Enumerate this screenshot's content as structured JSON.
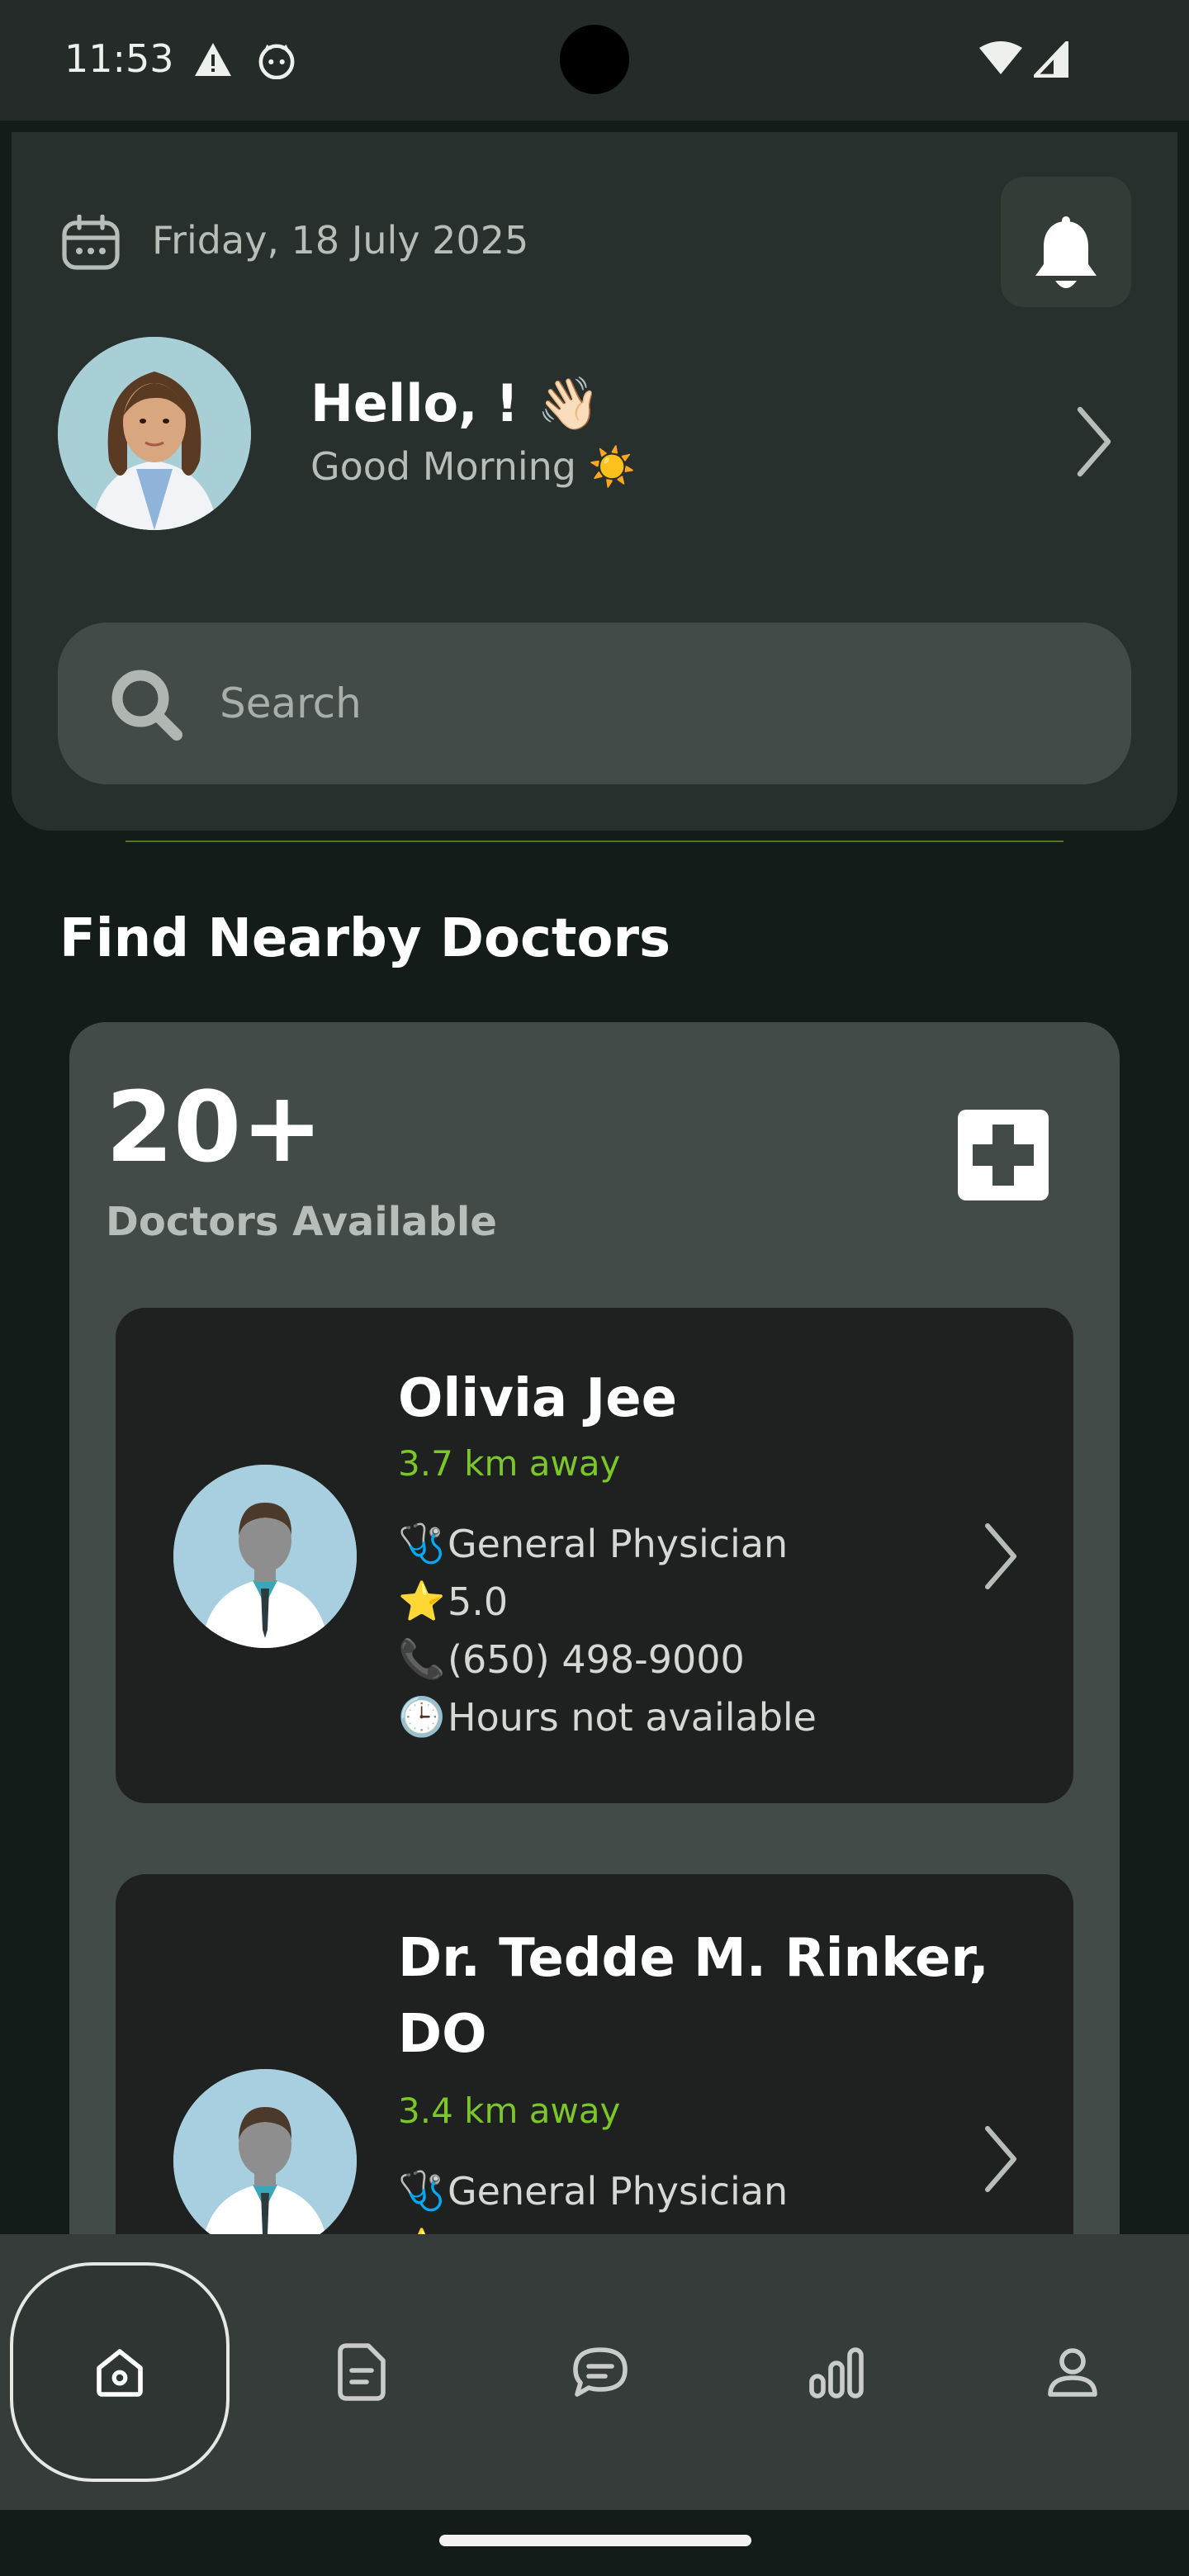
{
  "status_bar": {
    "time": "11:53"
  },
  "header": {
    "date": "Friday, 18 July 2025",
    "greeting": "Hello,  ! 👋🏻",
    "subgreeting": "Good Morning ☀️"
  },
  "search": {
    "placeholder": "Search"
  },
  "section": {
    "title": "Find Nearby Doctors"
  },
  "summary": {
    "count": "20+",
    "label": "Doctors Available"
  },
  "doctors": [
    {
      "name": "Olivia Jee",
      "distance": "3.7 km away",
      "specialty_emoji": "🩺",
      "specialty": "General Physician",
      "rating_emoji": "⭐",
      "rating": "5.0",
      "phone_emoji": "📞",
      "phone": "(650) 498-9000",
      "hours_emoji": "🕒",
      "hours": "Hours not available"
    },
    {
      "name": "Dr. Tedde M. Rinker, DO",
      "distance": "3.4 km away",
      "specialty_emoji": "🩺",
      "specialty": "General Physician",
      "rating_emoji": "⭐"
    }
  ],
  "bottom_nav": {
    "active": "home",
    "items": [
      "home-icon",
      "document-icon",
      "chat-icon",
      "stats-icon",
      "profile-icon"
    ]
  },
  "colors": {
    "background": "#141c19",
    "header_card": "#27302c",
    "panel": "#424b47",
    "card": "#1f2120",
    "accent_green": "#7cc62a"
  }
}
